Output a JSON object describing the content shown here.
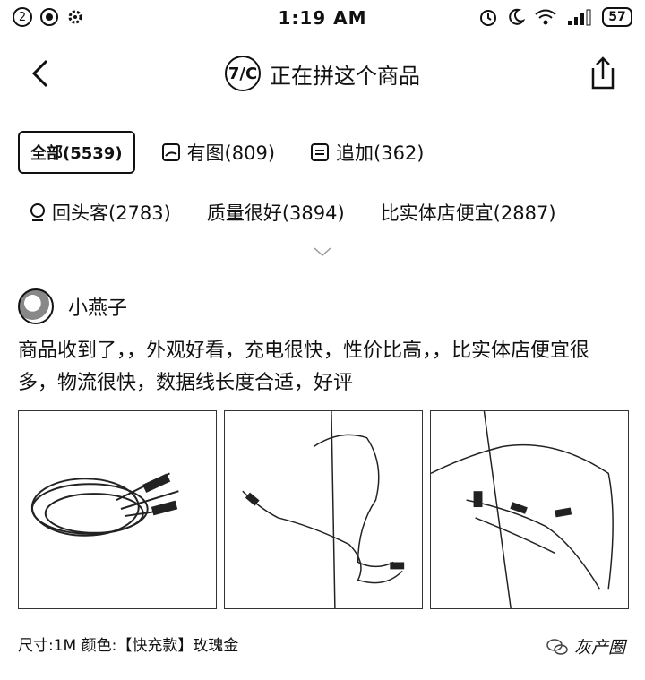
{
  "status_bar": {
    "notif_count": "2",
    "time": "1:19 AM",
    "battery": "57"
  },
  "header": {
    "title": "正在拼这个商品",
    "avatar_text": "7/C"
  },
  "filters": {
    "tabs": [
      {
        "label": "全部(5539)",
        "icon": ""
      },
      {
        "label": "有图(809)",
        "icon": "image-icon"
      },
      {
        "label": "追加(362)",
        "icon": "note-icon"
      }
    ],
    "tags": [
      {
        "label": "回头客(2783)",
        "icon": "person-icon"
      },
      {
        "label": "质量很好(3894)"
      },
      {
        "label": "比实体店便宜(2887)"
      }
    ]
  },
  "review": {
    "username": "小燕子",
    "text": "商品收到了，，外观好看，充电很快，性价比高，，比实体店便宜很多，物流很快，数据线长度合适，好评",
    "sku": "尺寸:1M  颜色:【快充款】玫瑰金"
  },
  "watermark": "灰产圈"
}
